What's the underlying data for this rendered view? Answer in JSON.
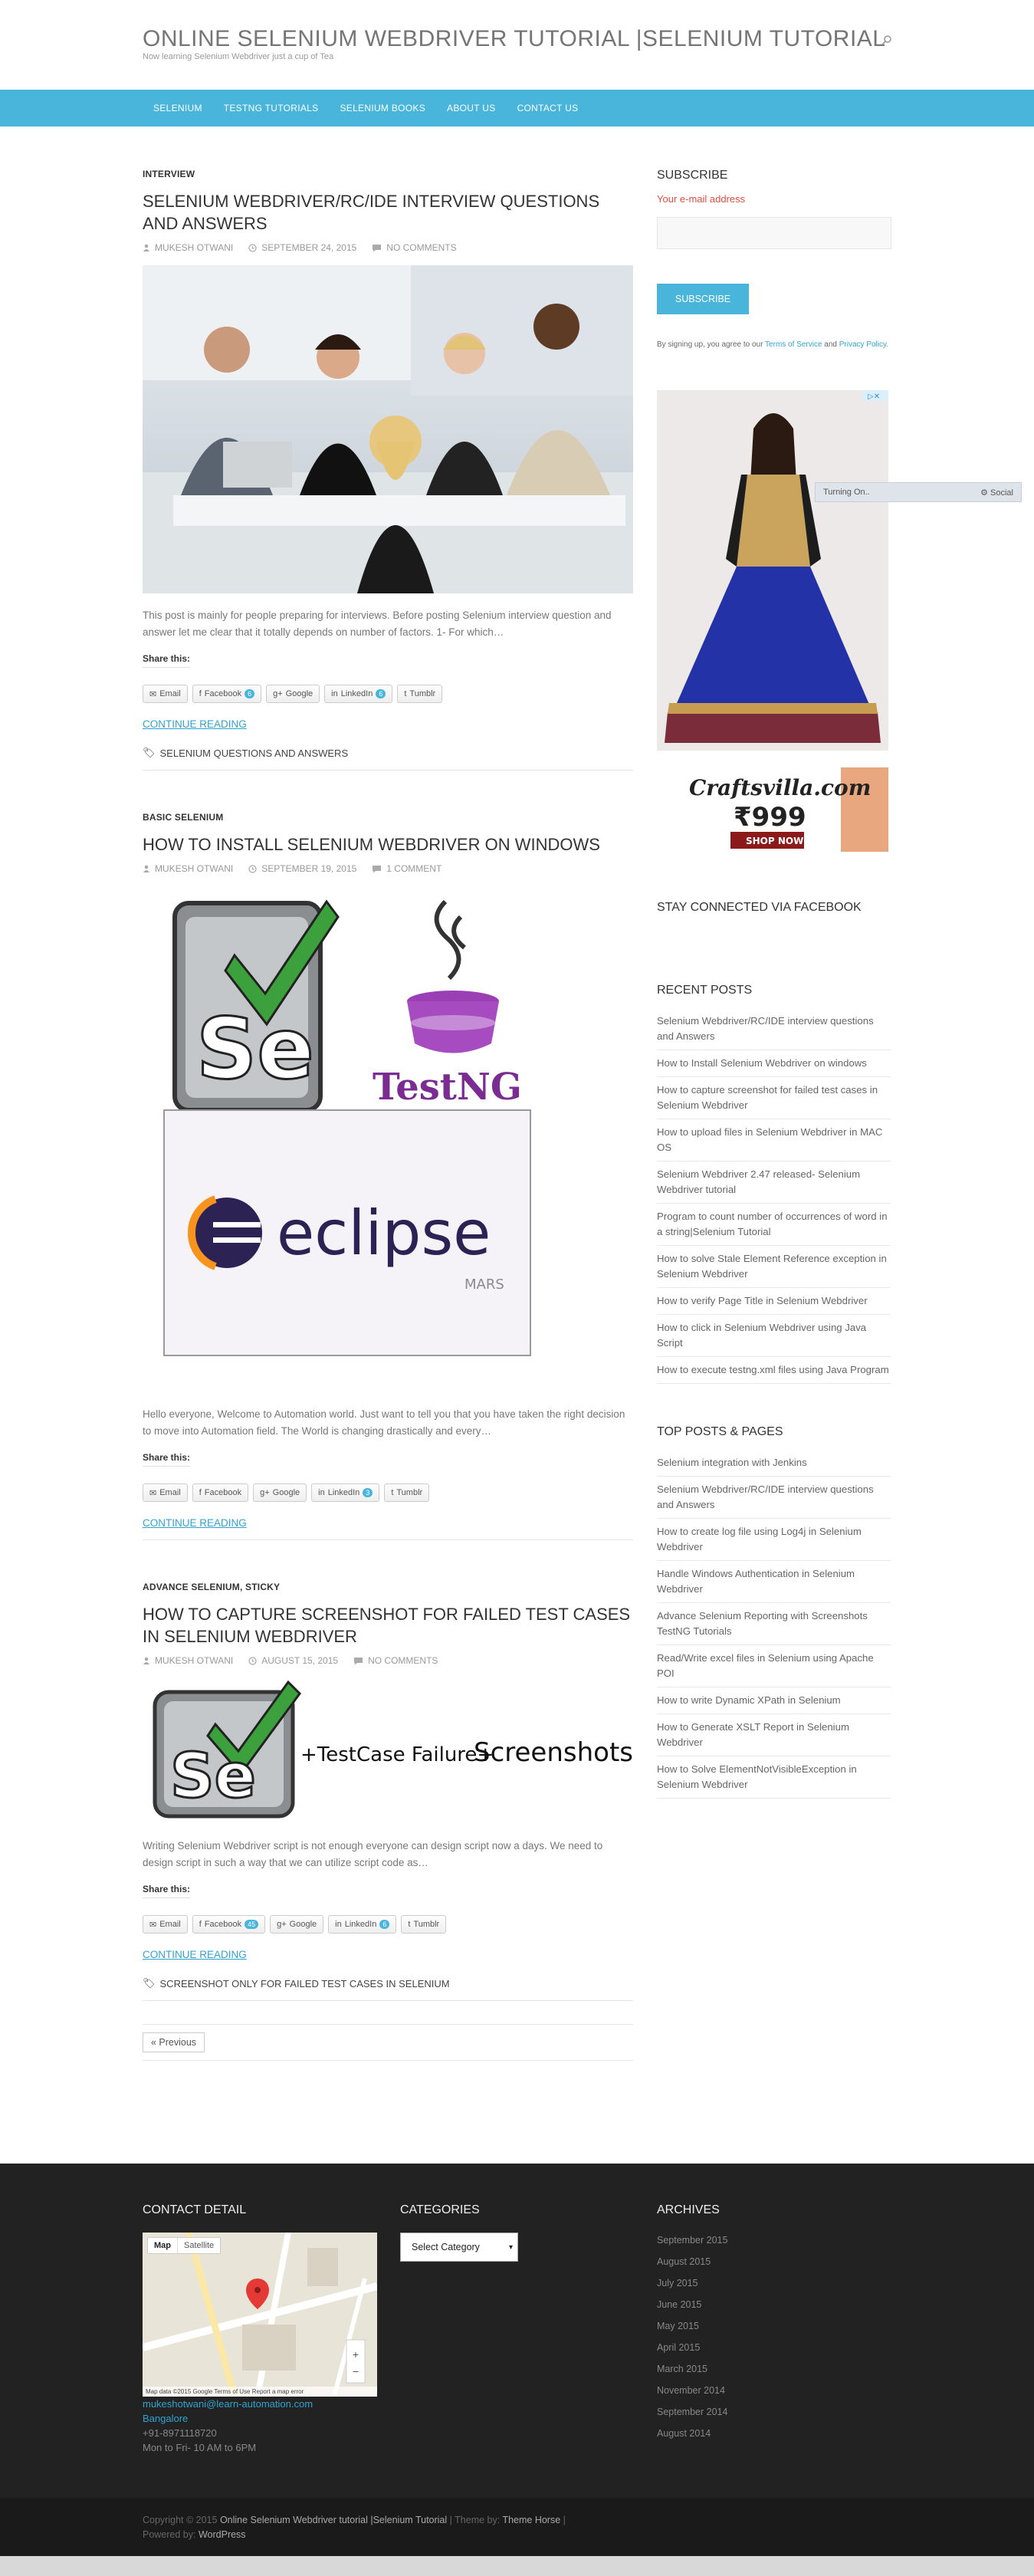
{
  "site": {
    "title": "ONLINE SELENIUM WEBDRIVER TUTORIAL |SELENIUM TUTORIAL",
    "tagline": "Now learning Selenium Webdriver just a cup of Tea"
  },
  "nav": {
    "items": [
      "SELENIUM",
      "TESTNG TUTORIALS",
      "SELENIUM BOOKS",
      "ABOUT US",
      "CONTACT US"
    ]
  },
  "posts": [
    {
      "category": "INTERVIEW",
      "title": "SELENIUM WEBDRIVER/RC/IDE INTERVIEW QUESTIONS AND ANSWERS",
      "author": "MUKESH OTWANI",
      "date": "SEPTEMBER 24, 2015",
      "comments": "NO COMMENTS",
      "excerpt": "This post is mainly for people preparing for interviews. Before posting Selenium interview question and answer let me clear that it totally depends on number of factors.   1- For which…",
      "share_label": "Share this:",
      "share": {
        "email": "Email",
        "facebook": "Facebook",
        "facebook_count": "6",
        "google": "Google",
        "linkedin": "LinkedIn",
        "linkedin_count": "6",
        "tumblr": "Tumblr"
      },
      "continue": "CONTINUE READING",
      "tag": "SELENIUM QUESTIONS AND ANSWERS"
    },
    {
      "category": "BASIC SELENIUM",
      "title": "HOW TO INSTALL SELENIUM WEBDRIVER ON WINDOWS",
      "author": "MUKESH OTWANI",
      "date": "SEPTEMBER 19, 2015",
      "comments": "1 COMMENT",
      "img_testng": "TestNG",
      "img_eclipse": "eclipse",
      "img_mars": "MARS",
      "excerpt": "Hello everyone, Welcome to Automation world. Just want to tell you that you have taken the right decision to move into Automation field. The World is changing drastically and every…",
      "share_label": "Share this:",
      "share": {
        "email": "Email",
        "facebook": "Facebook",
        "google": "Google",
        "linkedin": "LinkedIn",
        "linkedin_count": "3",
        "tumblr": "Tumblr"
      },
      "continue": "CONTINUE READING"
    },
    {
      "category": "ADVANCE SELENIUM, STICKY",
      "title": "HOW TO CAPTURE SCREENSHOT FOR FAILED TEST CASES IN SELENIUM WEBDRIVER",
      "author": "MUKESH OTWANI",
      "date": "AUGUST 15, 2015",
      "comments": "NO COMMENTS",
      "img_caption_a": "+TestCase Failure+",
      "img_caption_b": "Screenshots",
      "excerpt": "Writing Selenium Webdriver script is not enough everyone can design script now a days. We need to design script in such a way that we can utilize script code as…",
      "share_label": "Share this:",
      "share": {
        "email": "Email",
        "facebook": "Facebook",
        "facebook_count": "45",
        "google": "Google",
        "linkedin": "LinkedIn",
        "linkedin_count": "6",
        "tumblr": "Tumblr"
      },
      "continue": "CONTINUE READING",
      "tag": "SCREENSHOT ONLY FOR FAILED TEST CASES IN SELENIUM"
    }
  ],
  "pager": {
    "previous": "« Previous"
  },
  "sidebar": {
    "subscribe_title": "SUBSCRIBE",
    "email_label": "Your e-mail address",
    "subscribe_button": "SUBSCRIBE",
    "terms_a": "By signing up, you agree to our",
    "terms_link1": "Terms of Service",
    "terms_and": "and",
    "terms_link2": "Privacy Policy.",
    "ad_brand": "Craftsvilla.com",
    "ad_price": "₹999",
    "ad_cta": "SHOP NOW",
    "ad_overlay": "Turning On..",
    "ad_social": "Social",
    "facebook_title": "STAY CONNECTED VIA FACEBOOK",
    "recent_title": "RECENT POSTS",
    "recent_posts": [
      "Selenium Webdriver/RC/IDE interview questions and Answers",
      "How to Install Selenium Webdriver on windows",
      "How to capture screenshot for failed test cases in Selenium Webdriver",
      "How to upload files in Selenium Webdriver in MAC OS",
      "Selenium Webdriver 2.47 released- Selenium Webdriver tutorial",
      "Program to count number of occurrences of word in a string|Selenium Tutorial",
      "How to solve Stale Element Reference exception in Selenium Webdriver",
      "How to verify Page Title in Selenium Webdriver",
      "How to click in Selenium Webdriver using Java Script",
      "How to execute testng.xml files using Java Program"
    ],
    "top_title": "TOP POSTS & PAGES",
    "top_posts": [
      "Selenium integration with Jenkins",
      "Selenium Webdriver/RC/IDE interview questions and Answers",
      "How to create log file using Log4j in Selenium Webdriver",
      "Handle Windows Authentication in Selenium Webdriver",
      "Advance Selenium Reporting with Screenshots TestNG Tutorials",
      "Read/Write excel files in Selenium using Apache POI",
      "How to write Dynamic XPath in Selenium",
      "How to Generate XSLT Report in Selenium Webdriver",
      "How to Solve ElementNotVisibleException in Selenium Webdriver"
    ]
  },
  "footer": {
    "contact_title": "CONTACT DETAIL",
    "map_tab": "Map",
    "satellite_tab": "Satellite",
    "map_credit": "Map data ©2015 Google   Terms of Use   Report a map error",
    "email": "mukeshotwani@learn-automation.com",
    "city": "Bangalore",
    "phone": "+91-8971118720",
    "hours": "Mon to Fri- 10 AM to 6PM",
    "categories_title": "CATEGORIES",
    "select_default": "Select Category",
    "archives_title": "ARCHIVES",
    "archives": [
      "September 2015",
      "August 2015",
      "July 2015",
      "June 2015",
      "May 2015",
      "April 2015",
      "March 2015",
      "November 2014",
      "September 2014",
      "August 2014"
    ]
  },
  "copyright": {
    "prefix": "Copyright © 2015",
    "site": "Online Selenium Webdriver tutorial |Selenium Tutorial",
    "theme_by": "| Theme by:",
    "theme": "Theme Horse",
    "sep": "|",
    "powered": "Powered by:",
    "wp": "WordPress"
  },
  "colors": {
    "accent": "#49b5db",
    "link": "#30a4cf",
    "footer": "#222222",
    "label_red": "#e74c3c"
  }
}
